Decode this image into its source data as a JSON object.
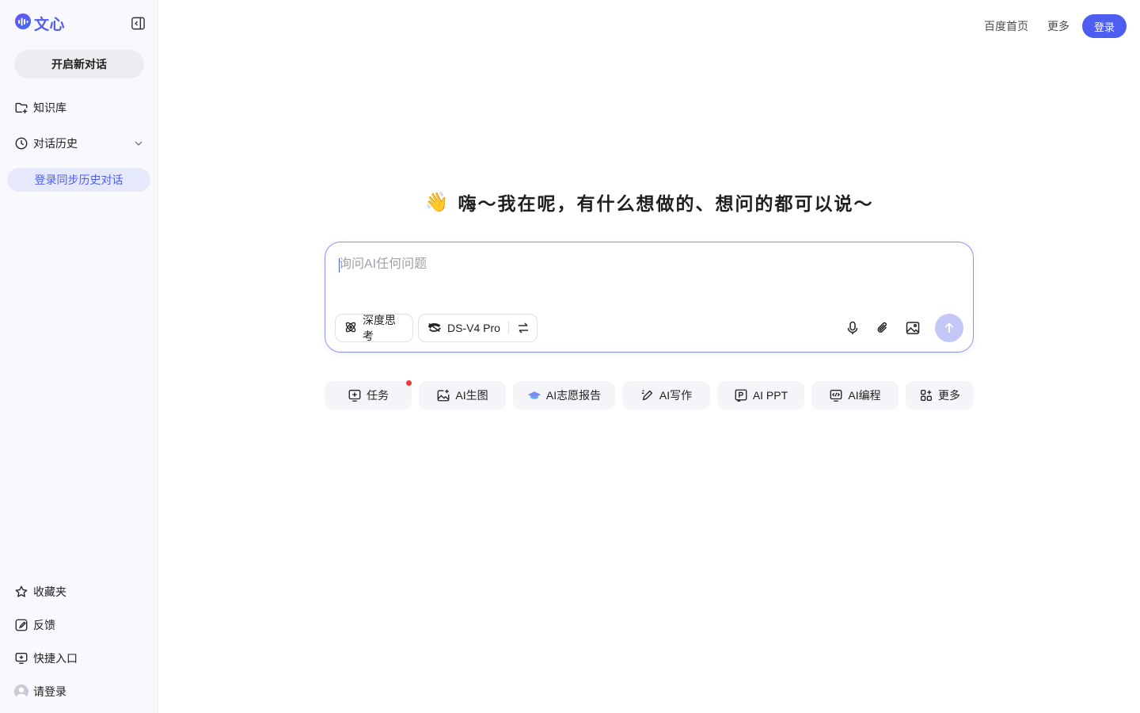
{
  "brand": {
    "name": "文心",
    "accent": "#4e5ef0"
  },
  "sidebar": {
    "new_chat": "开启新对话",
    "knowledge": "知识库",
    "history": "对话历史",
    "sync": "登录同步历史对话",
    "favorites": "收藏夹",
    "feedback": "反馈",
    "shortcut": "快捷入口",
    "login": "请登录"
  },
  "top_nav": {
    "home": "百度首页",
    "more": "更多",
    "login": "登录"
  },
  "greeting": {
    "emoji": "👋",
    "text": "嗨～我在呢，有什么想做的、想问的都可以说～"
  },
  "input": {
    "placeholder": "询问AI任何问题",
    "deep_think": "深度思考",
    "model": "DS-V4 Pro"
  },
  "quick_actions": [
    {
      "label": "任务",
      "icon": "task-icon",
      "has_dot": true
    },
    {
      "label": "AI生图",
      "icon": "image-gen-icon"
    },
    {
      "label": "AI志愿报告",
      "icon": "graduation-icon"
    },
    {
      "label": "AI写作",
      "icon": "pen-icon"
    },
    {
      "label": "AI PPT",
      "icon": "ppt-icon"
    },
    {
      "label": "AI编程",
      "icon": "code-icon"
    },
    {
      "label": "更多",
      "icon": "apps-icon"
    }
  ]
}
